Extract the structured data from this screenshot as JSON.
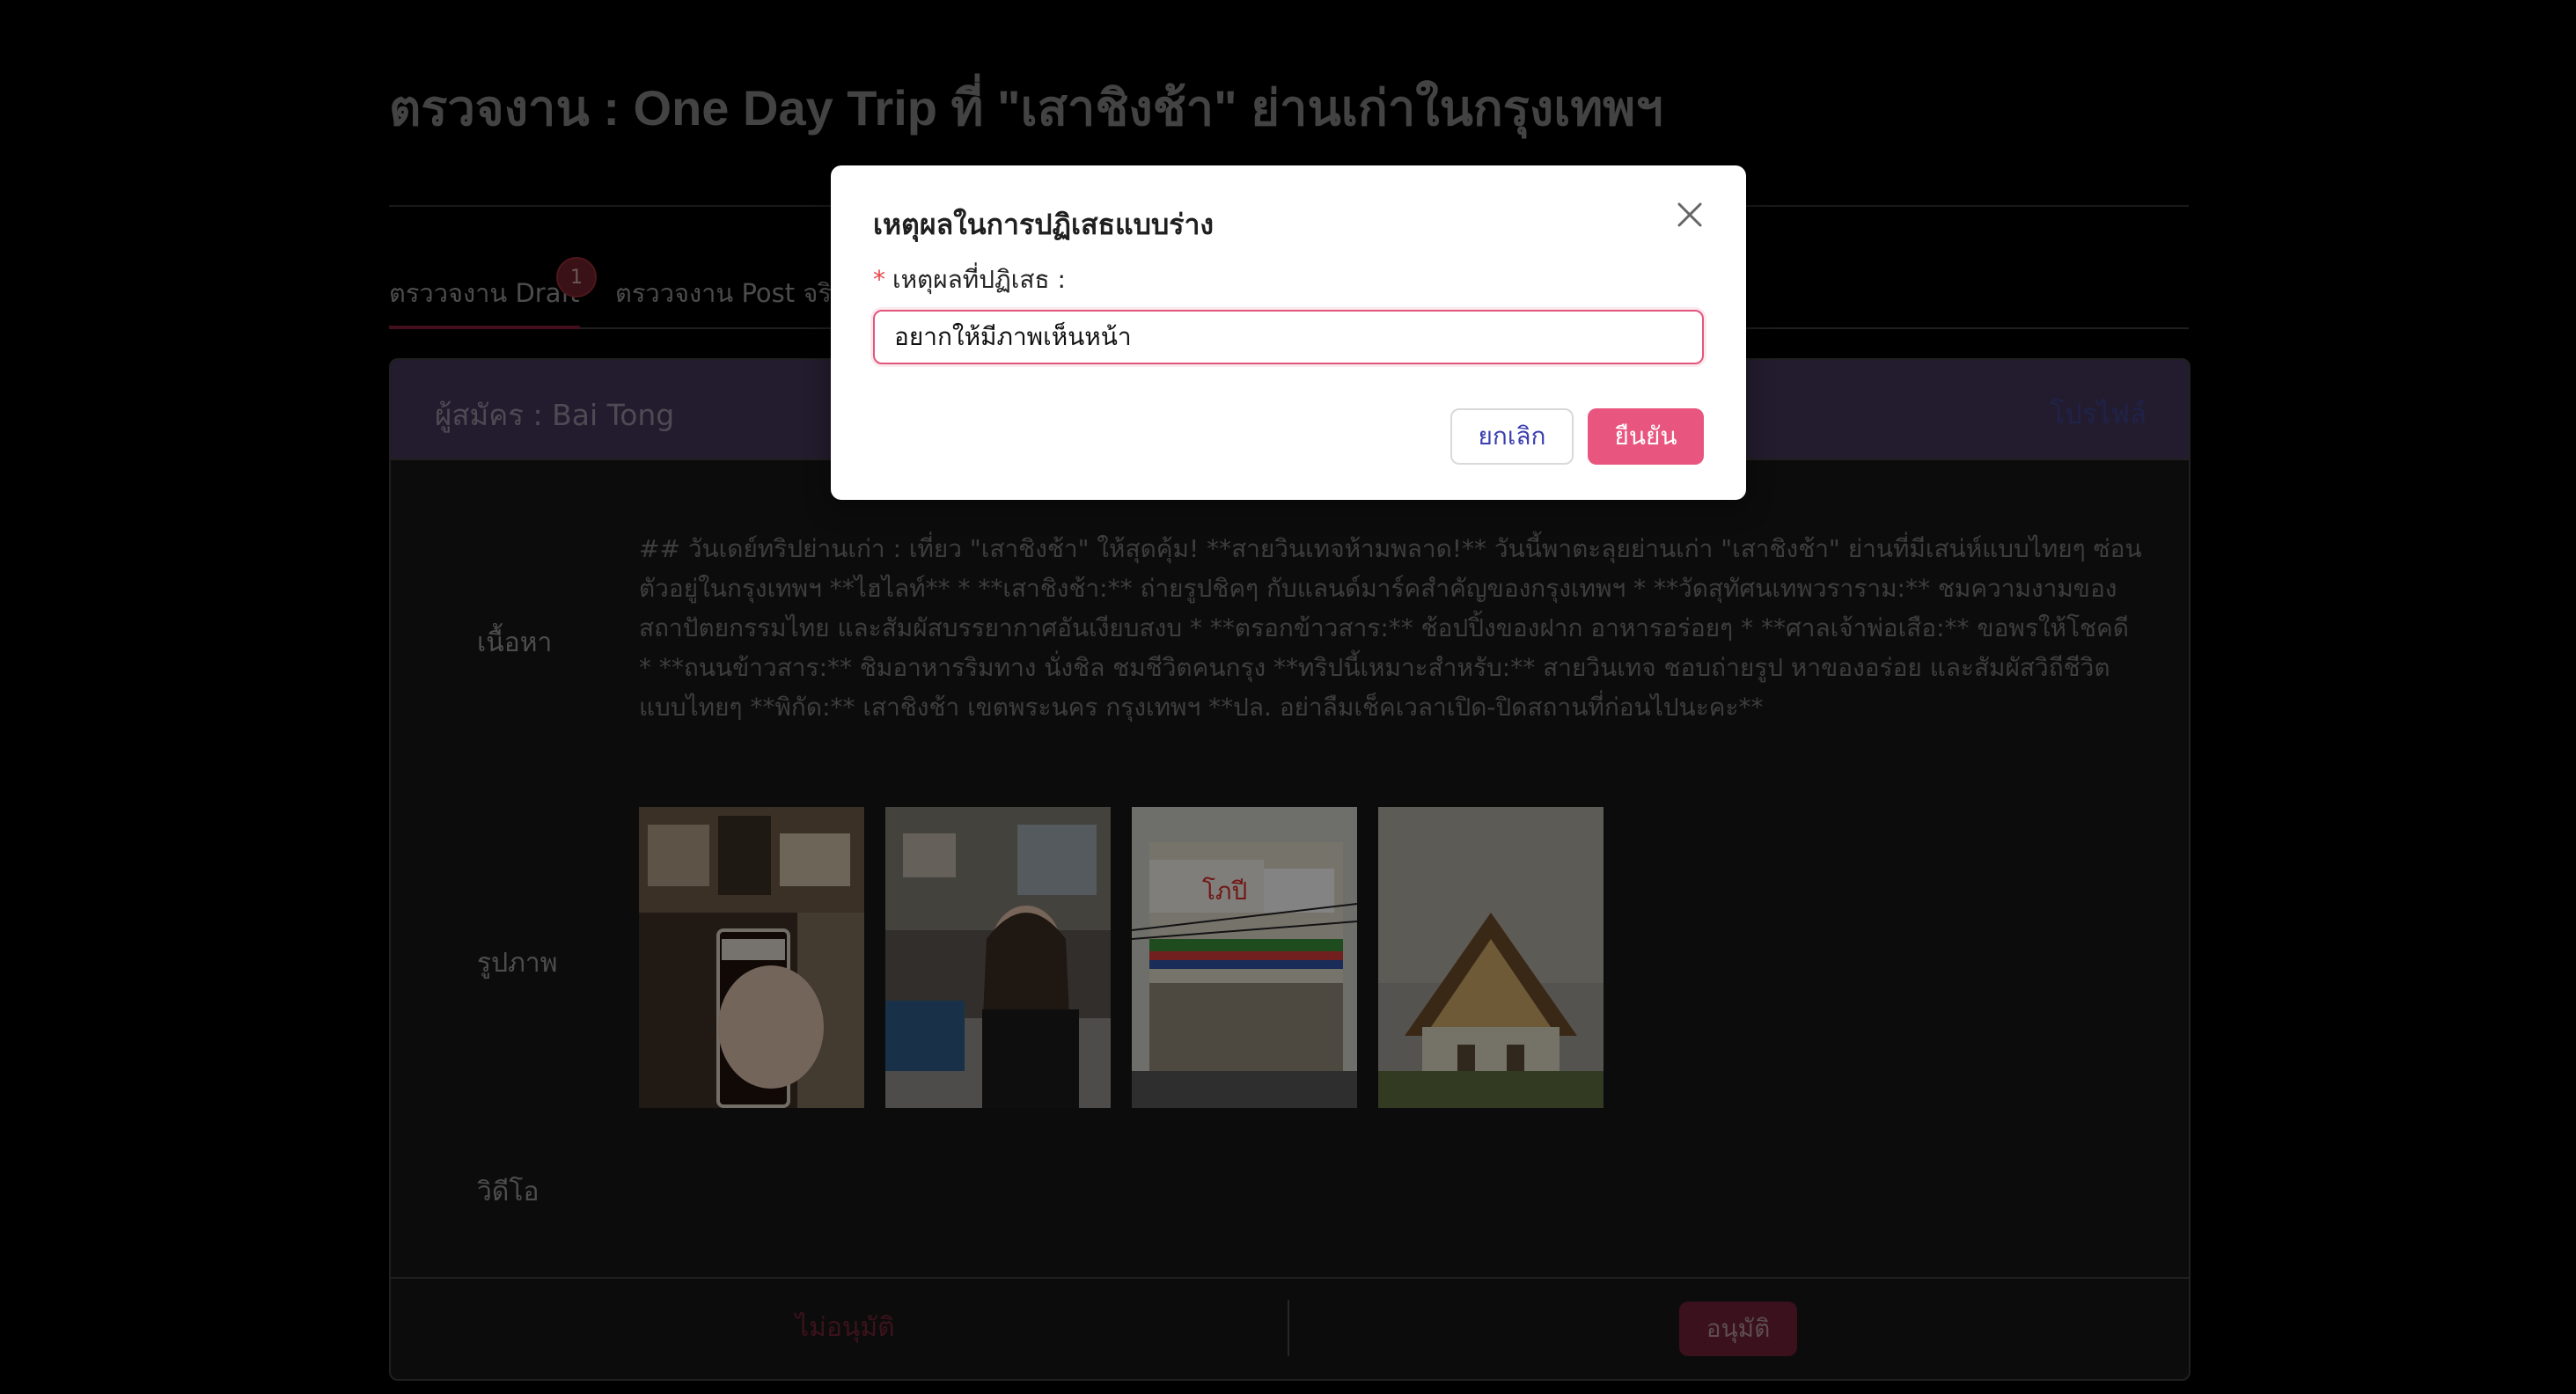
{
  "page": {
    "title": "ตรวจงาน : One Day Trip ที่ \"เสาชิงช้า\" ย่านเก่าในกรุงเทพฯ"
  },
  "tabs": [
    {
      "label": "ตรววจงาน Draft",
      "badge": "1",
      "active": true
    },
    {
      "label": "ตรววจงาน Post จริง",
      "active": false
    }
  ],
  "card": {
    "applicant": "ผู้สมัคร : Bai Tong",
    "profile_link": "โปรไฟล์",
    "labels": {
      "content": "เนื้อหา",
      "images": "รูปภาพ",
      "video": "วิดีโอ"
    },
    "content_text": "## วันเดย์ทริปย่านเก่า : เที่ยว \"เสาชิงช้า\" ให้สุดคุ้ม! **สายวินเทจห้ามพลาด!** วันนี้พาตะลุยย่านเก่า \"เสาชิงช้า\" ย่านที่มีเสน่ห์แบบไทยๆ ซ่อนตัวอยู่ในกรุงเทพฯ **ไฮไลท์** * **เสาชิงช้า:** ถ่ายรูปชิคๆ กับแลนด์มาร์คสำคัญของกรุงเทพฯ * **วัดสุทัศนเทพวราราม:** ชมความงามของสถาปัตยกรรมไทย และสัมผัสบรรยากาศอันเงียบสงบ * **ตรอกข้าวสาร:** ช้อปปิ้งของฝาก อาหารอร่อยๆ * **ศาลเจ้าพ่อเสือ:** ขอพรให้โชคดี * **ถนนข้าวสาร:** ชิมอาหารริมทาง นั่งชิล ชมชีวิตคนกรุง **ทริปนี้เหมาะสำหรับ:** สายวินเทจ ชอบถ่ายรูป หาของอร่อย และสัมผัสวิถีชีวิตแบบไทยๆ **พิกัด:** เสาชิงช้า เขตพระนคร กรุงเทพฯ **ปล. อย่าลืมเช็คเวลาเปิด-ปิดสถานที่ก่อนไปนะคะ**",
    "photos": [
      "photo-drink-glass",
      "photo-woman-eating",
      "photo-shophouse-building",
      "photo-thai-temple"
    ],
    "reject_label": "ไม่อนุมัติ",
    "approve_label": "อนุมัติ"
  },
  "modal": {
    "title": "เหตุผลในการปฏิเสธแบบร่าง",
    "field_label": "เหตุผลที่ปฏิเสธ :",
    "required_mark": "*",
    "input_value": "อยากให้มีภาพเห็นหน้า",
    "cancel_label": "ยกเลิก",
    "confirm_label": "ยืนยัน"
  },
  "colors": {
    "background": "#000000",
    "card_header": "#403454",
    "accent_pink": "#e8567f",
    "tab_indicator": "#7a1d33"
  }
}
